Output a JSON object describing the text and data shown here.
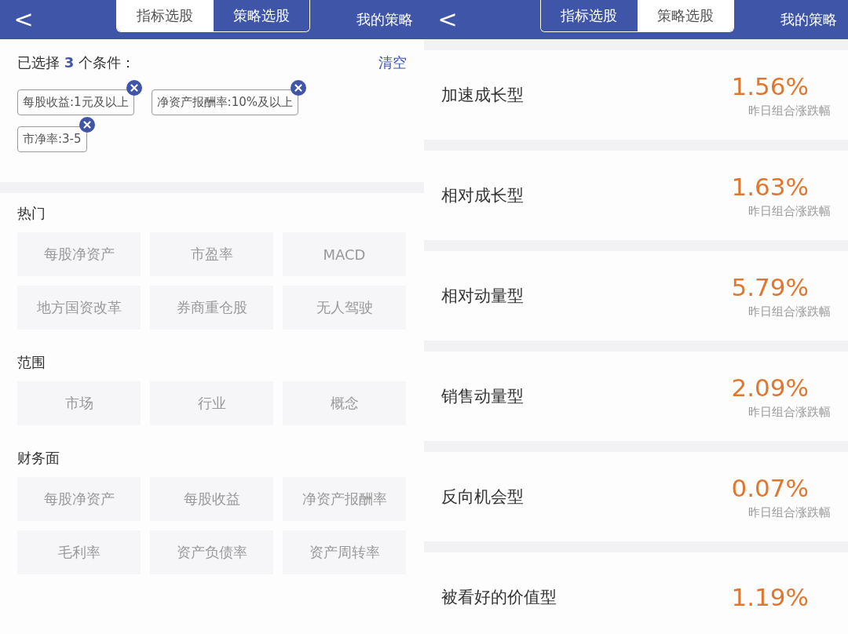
{
  "left_screen": {
    "back": "<",
    "tabs": [
      {
        "label": "指标选股",
        "selected": true
      },
      {
        "label": "策略选股",
        "selected": false
      }
    ],
    "my_strategy": "我的策略",
    "selected_summary": "已选择 **3** 个条件：",
    "clear": "清空",
    "chips": [
      {
        "label": "每股收益:1元及以上"
      },
      {
        "label": "净资产报酬率:10%及以上"
      },
      {
        "label": "市净率:3-5"
      }
    ],
    "sections": [
      {
        "title": "热门",
        "options": [
          "每股净资产",
          "市盈率",
          "MACD",
          "地方国资改革",
          "券商重仓股",
          "无人驾驶"
        ]
      },
      {
        "title": "范围",
        "options": [
          "市场",
          "行业",
          "概念"
        ]
      },
      {
        "title": "财务面",
        "options": [
          "每股净资产",
          "每股收益",
          "净资产报酬率",
          "毛利率",
          "资产负债率",
          "资产周转率"
        ]
      }
    ]
  },
  "right_screen": {
    "back": "<",
    "tabs": [
      {
        "label": "指标选股",
        "selected": false
      },
      {
        "label": "策略选股",
        "selected": true
      }
    ],
    "my_strategy": "我的策略",
    "strategies": [
      {
        "name": "加速成长型",
        "change": "1.56%",
        "caption": "昨日组合涨跌幅"
      },
      {
        "name": "相对成长型",
        "change": "1.63%",
        "caption": "昨日组合涨跌幅"
      },
      {
        "name": "相对动量型",
        "change": "5.79%",
        "caption": "昨日组合涨跌幅"
      },
      {
        "name": "销售动量型",
        "change": "2.09%",
        "caption": "昨日组合涨跌幅"
      },
      {
        "name": "反向机会型",
        "change": "0.07%",
        "caption": "昨日组合涨跌幅"
      },
      {
        "name": "被看好的价值型",
        "change": "1.19%"
      }
    ]
  }
}
